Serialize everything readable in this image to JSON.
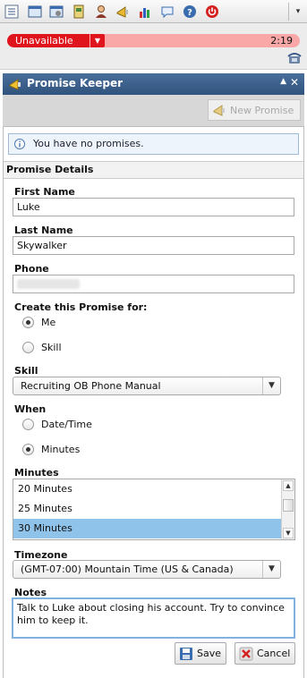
{
  "toolbar": {
    "icons": [
      "list-icon",
      "window-icon",
      "window-settings-icon",
      "address-book-icon",
      "agent-icon",
      "megaphone-icon",
      "bar-chart-icon",
      "chat-icon",
      "help-icon",
      "power-icon"
    ],
    "menu_caret": "▾"
  },
  "status": {
    "state": "Unavailable",
    "timer": "2:19",
    "colors": {
      "state_fill": "#e0141d",
      "bar_fill": "#f9a7a7"
    }
  },
  "panel": {
    "title": "Promise Keeper",
    "new_promise_label": "New Promise",
    "notice": "You have no promises.",
    "section_title": "Promise Details",
    "header_color": "#3b5f8a"
  },
  "form": {
    "first_name_label": "First Name",
    "first_name_value": "Luke",
    "last_name_label": "Last Name",
    "last_name_value": "Skywalker",
    "phone_label": "Phone",
    "create_for_label": "Create this Promise for:",
    "create_for_options": [
      "Me",
      "Skill"
    ],
    "create_for_selected": "Me",
    "skill_label": "Skill",
    "skill_value": "Recruiting OB Phone Manual",
    "when_label": "When",
    "when_options": [
      "Date/Time",
      "Minutes"
    ],
    "when_selected": "Minutes",
    "minutes_label": "Minutes",
    "minutes_options": [
      "20 Minutes",
      "25 Minutes",
      "30 Minutes"
    ],
    "minutes_selected": "30 Minutes",
    "timezone_label": "Timezone",
    "timezone_value": "(GMT-07:00) Mountain Time (US & Canada)",
    "notes_label": "Notes",
    "notes_value": "Talk to Luke about closing his account. Try to convince him to keep it."
  },
  "buttons": {
    "save": "Save",
    "cancel": "Cancel"
  }
}
